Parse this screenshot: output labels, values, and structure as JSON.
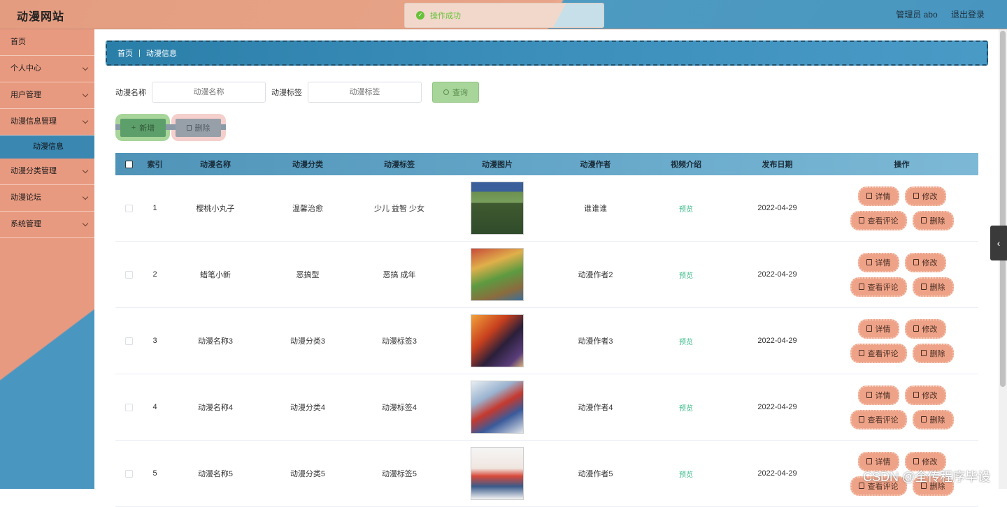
{
  "header": {
    "brand": "动漫网站",
    "user": "管理员 abo",
    "logout": "退出登录",
    "toast": "操作成功"
  },
  "sidebar": {
    "items": [
      {
        "label": "首页"
      },
      {
        "label": "个人中心"
      },
      {
        "label": "用户管理"
      },
      {
        "label": "动漫信息管理"
      },
      {
        "label": "动漫信息"
      },
      {
        "label": "动漫分类管理"
      },
      {
        "label": "动漫论坛"
      },
      {
        "label": "系统管理"
      }
    ]
  },
  "breadcrumb": {
    "home": "首页",
    "current": "动漫信息"
  },
  "search": {
    "name_label": "动漫名称",
    "name_placeholder": "动漫名称",
    "tag_label": "动漫标签",
    "tag_placeholder": "动漫标签",
    "query_label": "查询"
  },
  "actions": {
    "add_label": "新增",
    "delete_label": "删除"
  },
  "table": {
    "headers": {
      "index": "索引",
      "name": "动漫名称",
      "category": "动漫分类",
      "tags": "动漫标签",
      "image": "动漫图片",
      "author": "动漫作者",
      "video": "视频介绍",
      "date": "发布日期",
      "ops": "操作"
    },
    "op_labels": {
      "detail": "详情",
      "edit": "修改",
      "comments": "查看评论",
      "delete": "删除"
    },
    "rows": [
      {
        "index": "1",
        "name": "樱桃小丸子",
        "category": "温馨治愈",
        "tags": "少儿 益智 少女",
        "author": "谁谁谁",
        "video": "预览",
        "date": "2022-04-29"
      },
      {
        "index": "2",
        "name": "蜡笔小新",
        "category": "恶搞型",
        "tags": "恶搞 成年",
        "author": "动漫作者2",
        "video": "预览",
        "date": "2022-04-29"
      },
      {
        "index": "3",
        "name": "动漫名称3",
        "category": "动漫分类3",
        "tags": "动漫标签3",
        "author": "动漫作者3",
        "video": "预览",
        "date": "2022-04-29"
      },
      {
        "index": "4",
        "name": "动漫名称4",
        "category": "动漫分类4",
        "tags": "动漫标签4",
        "author": "动漫作者4",
        "video": "预览",
        "date": "2022-04-29"
      },
      {
        "index": "5",
        "name": "动漫名称5",
        "category": "动漫分类5",
        "tags": "动漫标签5",
        "author": "动漫作者5",
        "video": "预览",
        "date": "2022-04-29"
      }
    ]
  },
  "watermark": "CSDN @全传程序毕设"
}
